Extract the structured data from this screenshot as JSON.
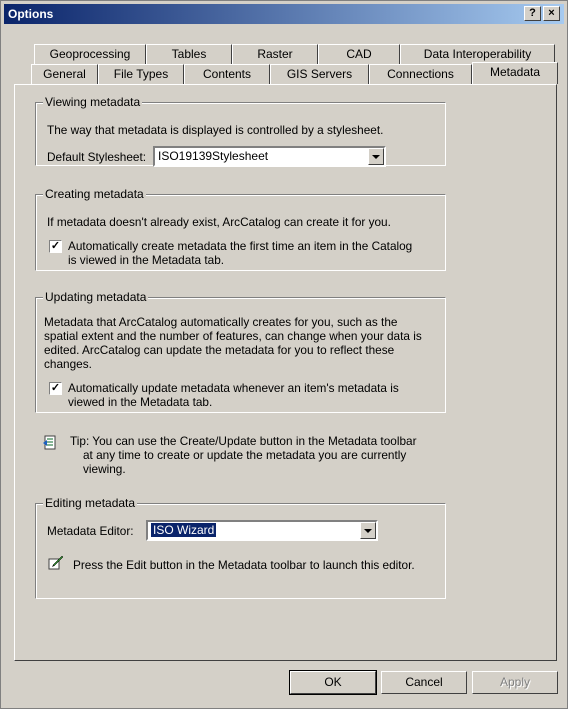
{
  "window": {
    "title": "Options",
    "help_label": "?",
    "close_label": "×"
  },
  "tabs_row_back": [
    "Geoprocessing",
    "Tables",
    "Raster",
    "CAD",
    "Data Interoperability"
  ],
  "tabs_row_front": [
    "General",
    "File Types",
    "Contents",
    "GIS Servers",
    "Connections",
    "Metadata"
  ],
  "active_tab": "Metadata",
  "viewing": {
    "legend": "Viewing metadata",
    "description": "The way that metadata is displayed is controlled by a stylesheet.",
    "stylesheet_label": "Default Stylesheet:",
    "stylesheet_value": "ISO19139Stylesheet"
  },
  "creating": {
    "legend": "Creating metadata",
    "description": "If metadata doesn't already exist, ArcCatalog can create it for you.",
    "checkbox_line1": "Automatically create metadata the first time an item in the Catalog",
    "checkbox_line2": "is viewed in the Metadata tab.",
    "checked": true
  },
  "updating": {
    "legend": "Updating metadata",
    "line1": "Metadata that ArcCatalog automatically creates for you, such as the",
    "line2": "spatial extent and the number of features, can change when your data is",
    "line3": "edited.  ArcCatalog can update the metadata for you to reflect these",
    "line4": "changes.",
    "checkbox_line1": "Automatically update metadata whenever an item's metadata is",
    "checkbox_line2": "viewed in the Metadata tab.",
    "checked": true
  },
  "tip": {
    "line1": "Tip: You can use the Create/Update button in the Metadata toolbar",
    "line2": "at any time to create or update the metadata you are currently",
    "line3": "viewing."
  },
  "editing": {
    "legend": "Editing metadata",
    "editor_label": "Metadata Editor:",
    "editor_value": "ISO Wizard",
    "hint": "Press the Edit button in the Metadata toolbar to launch this editor."
  },
  "buttons": {
    "ok": "OK",
    "cancel": "Cancel",
    "apply": "Apply"
  },
  "colors": {
    "titlebar_start": "#0a246a",
    "titlebar_end": "#a6caf0",
    "selection": "#0a246a",
    "face": "#d4d0c8"
  }
}
